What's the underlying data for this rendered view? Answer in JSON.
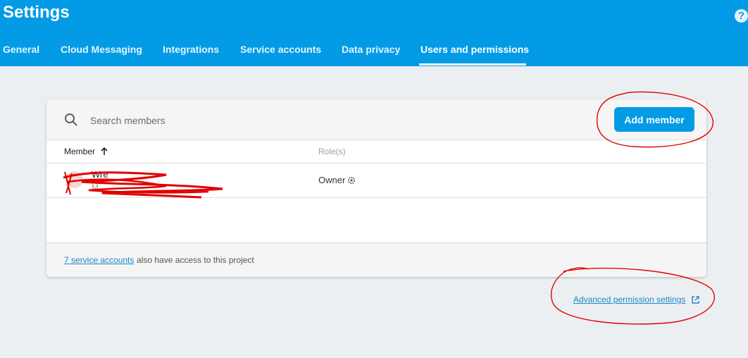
{
  "header": {
    "title": "Settings",
    "help_icon": "help-circle-icon",
    "tabs": [
      {
        "label": "General"
      },
      {
        "label": "Cloud Messaging"
      },
      {
        "label": "Integrations"
      },
      {
        "label": "Service accounts"
      },
      {
        "label": "Data privacy"
      },
      {
        "label": "Users and permissions",
        "active": true
      }
    ]
  },
  "members": {
    "search": {
      "placeholder": "Search members",
      "icon": "search-icon"
    },
    "add_button": "Add member",
    "columns": {
      "member": "Member",
      "role": "Role(s)"
    },
    "rows": [
      {
        "name": "Wre",
        "email": "M",
        "role": "Owner",
        "avatar_icon": "avatar-icon",
        "role_icon": "settings-icon"
      }
    ],
    "footer": {
      "link": "7 service accounts",
      "text": "also have access to this project"
    }
  },
  "advanced_link": {
    "label": "Advanced permission settings",
    "icon": "open-in-new-icon"
  },
  "colors": {
    "header_bg": "#039be5",
    "accent": "#039be5",
    "page_bg": "#eceff1",
    "annotation": "#e00000"
  }
}
